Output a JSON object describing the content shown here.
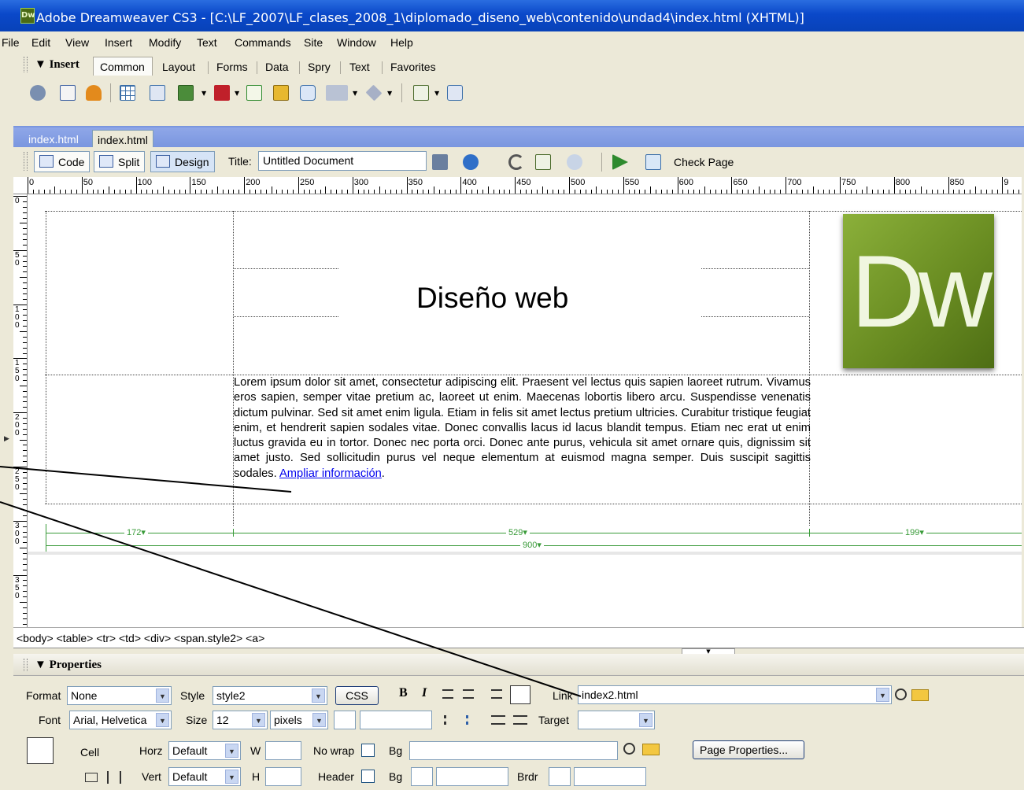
{
  "window": {
    "title": "Adobe Dreamweaver CS3 - [C:\\LF_2007\\LF_clases_2008_1\\diplomado_diseno_web\\contenido\\undad4\\index.html (XHTML)]",
    "logo_text": "Dw"
  },
  "menu": [
    "File",
    "Edit",
    "View",
    "Insert",
    "Modify",
    "Text",
    "Commands",
    "Site",
    "Window",
    "Help"
  ],
  "insert_bar": {
    "title": "▼ Insert",
    "tabs": [
      "Common",
      "Layout",
      "Forms",
      "Data",
      "Spry",
      "Text",
      "Favorites"
    ],
    "active_tab": "Common"
  },
  "doc_tabs": [
    "index.html",
    "index.html"
  ],
  "doc_toolbar": {
    "code": "Code",
    "split": "Split",
    "design": "Design",
    "title_label": "Title:",
    "title_value": "Untitled Document",
    "check_page": "Check Page"
  },
  "ruler_h": [
    "0",
    "50",
    "100",
    "150",
    "200",
    "250",
    "300",
    "350",
    "400",
    "450",
    "500",
    "550",
    "600",
    "650",
    "700",
    "750",
    "800",
    "850",
    "9"
  ],
  "ruler_v": [
    "0",
    "5\n0",
    "1\n0\n0",
    "1\n5\n0",
    "2\n0\n0",
    "2\n5\n0",
    "3\n0\n0",
    "3\n5\n0"
  ],
  "design": {
    "heading": "Diseño web",
    "logo_text": "Dw",
    "body": "Lorem ipsum dolor sit amet, consectetur adipiscing elit. Praesent vel lectus quis sapien laoreet rutrum. Vivamus eros sapien, semper vitae pretium ac, laoreet ut enim. Maecenas lobortis libero arcu. Suspendisse venenatis dictum pulvinar. Sed sit amet enim ligula. Etiam in felis sit amet lectus pretium ultricies. Curabitur tristique feugiat enim, et hendrerit sapien sodales vitae. Donec convallis lacus id lacus blandit tempus. Etiam nec erat ut enim luctus gravida eu in tortor. Donec nec porta orci. Donec ante purus, vehicula sit amet ornare quis, dignissim sit amet justo. Sed sollicitudin purus vel neque elementum at euismod magna semper. Duis suscipit sagittis sodales.",
    "link_text": "Ampliar información",
    "link_suffix": ".",
    "widths": {
      "col1": "172",
      "col2": "529",
      "col3": "199",
      "table": "900"
    }
  },
  "status_bar": {
    "tag_selector": "<body> <table> <tr> <td> <div> <span.style2> <a>"
  },
  "properties": {
    "title": "▼ Properties",
    "format_label": "Format",
    "format_value": "None",
    "style_label": "Style",
    "style_value": "style2",
    "css_button": "CSS",
    "bold": "B",
    "italic": "I",
    "link_label": "Link",
    "link_value": "index2.html",
    "font_label": "Font",
    "font_value": "Arial, Helvetica",
    "size_label": "Size",
    "size_value": "12",
    "size_unit": "pixels",
    "target_label": "Target",
    "target_value": "",
    "cell_label": "Cell",
    "horz_label": "Horz",
    "horz_value": "Default",
    "vert_label": "Vert",
    "vert_value": "Default",
    "w_label": "W",
    "h_label": "H",
    "nowrap_label": "No wrap",
    "header_label": "Header",
    "bg_label": "Bg",
    "bg2_label": "Bg",
    "brdr_label": "Brdr",
    "page_properties": "Page Properties..."
  },
  "colors": {
    "titlebar": "#0a48c9",
    "chrome": "#ece9d8",
    "guide_green": "#3a9b3a",
    "link": "#0000ee",
    "logo_green": "#6a8d22"
  }
}
